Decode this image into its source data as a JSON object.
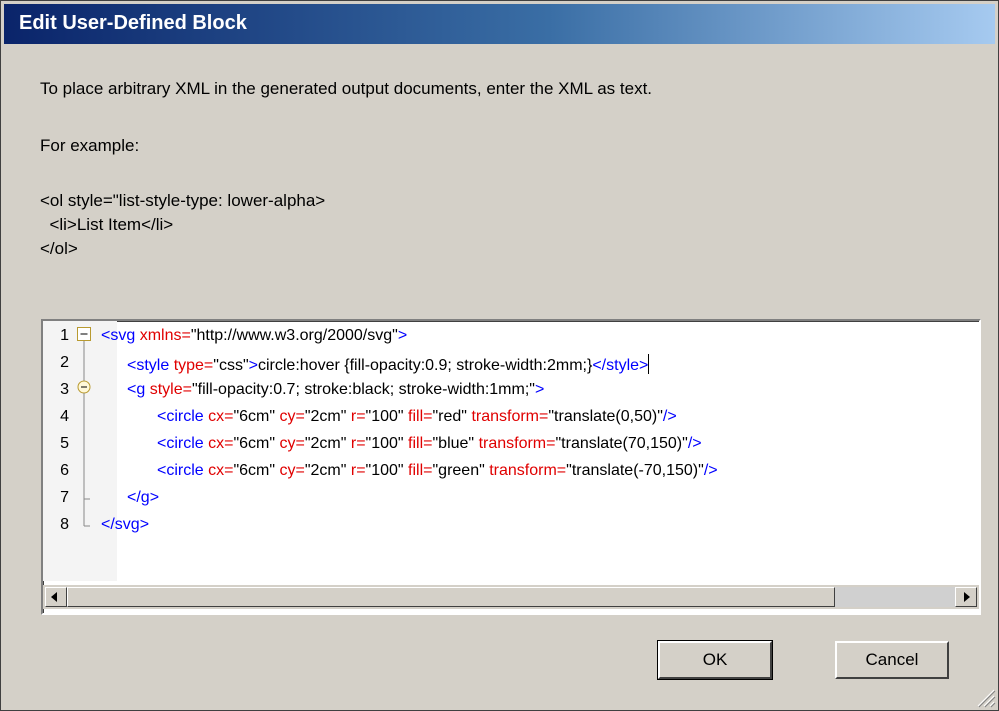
{
  "dialog": {
    "title": "Edit User-Defined Block"
  },
  "instructions": {
    "line1": "To place arbitrary XML in the generated output documents, enter the XML as text.",
    "example_label": "For example:",
    "example_line1": "<ol style=\"list-style-type: lower-alpha>",
    "example_line2": "  <li>List Item</li>",
    "example_line3": "</ol>"
  },
  "editor": {
    "line_numbers": [
      "1",
      "2",
      "3",
      "4",
      "5",
      "6",
      "7",
      "8"
    ],
    "lines": [
      [
        [
          "tag",
          "<svg "
        ],
        [
          "attr",
          "xmlns="
        ],
        [
          "val",
          "\"http://www.w3.org/2000/svg\""
        ],
        [
          "tag",
          ">"
        ]
      ],
      [
        [
          "tag",
          "<style "
        ],
        [
          "attr",
          "type="
        ],
        [
          "val",
          "\"css\""
        ],
        [
          "tag",
          ">"
        ],
        [
          "txt",
          "circle:hover {fill-opacity:0.9; stroke-width:2mm;}"
        ],
        [
          "tag",
          "</style>"
        ]
      ],
      [
        [
          "tag",
          "<g "
        ],
        [
          "attr",
          "style="
        ],
        [
          "val",
          "\"fill-opacity:0.7; stroke:black; stroke-width:1mm;\""
        ],
        [
          "tag",
          ">"
        ]
      ],
      [
        [
          "tag",
          "<circle "
        ],
        [
          "attr",
          "cx="
        ],
        [
          "val",
          "\"6cm\" "
        ],
        [
          "attr",
          "cy="
        ],
        [
          "val",
          "\"2cm\" "
        ],
        [
          "attr",
          "r="
        ],
        [
          "val",
          "\"100\" "
        ],
        [
          "attr",
          "fill="
        ],
        [
          "val",
          "\"red\" "
        ],
        [
          "attr",
          "transform="
        ],
        [
          "val",
          "\"translate(0,50)\""
        ],
        [
          "tag",
          "/>"
        ]
      ],
      [
        [
          "tag",
          "<circle "
        ],
        [
          "attr",
          "cx="
        ],
        [
          "val",
          "\"6cm\" "
        ],
        [
          "attr",
          "cy="
        ],
        [
          "val",
          "\"2cm\" "
        ],
        [
          "attr",
          "r="
        ],
        [
          "val",
          "\"100\" "
        ],
        [
          "attr",
          "fill="
        ],
        [
          "val",
          "\"blue\" "
        ],
        [
          "attr",
          "transform="
        ],
        [
          "val",
          "\"translate(70,150)\""
        ],
        [
          "tag",
          "/>"
        ]
      ],
      [
        [
          "tag",
          "<circle "
        ],
        [
          "attr",
          "cx="
        ],
        [
          "val",
          "\"6cm\" "
        ],
        [
          "attr",
          "cy="
        ],
        [
          "val",
          "\"2cm\" "
        ],
        [
          "attr",
          "r="
        ],
        [
          "val",
          "\"100\" "
        ],
        [
          "attr",
          "fill="
        ],
        [
          "val",
          "\"green\" "
        ],
        [
          "attr",
          "transform="
        ],
        [
          "val",
          "\"translate(-70,150)\""
        ],
        [
          "tag",
          "/>"
        ]
      ],
      [
        [
          "tag",
          "</g>"
        ]
      ],
      [
        [
          "tag",
          "</svg>"
        ]
      ]
    ]
  },
  "buttons": {
    "ok": "OK",
    "cancel": "Cancel"
  }
}
